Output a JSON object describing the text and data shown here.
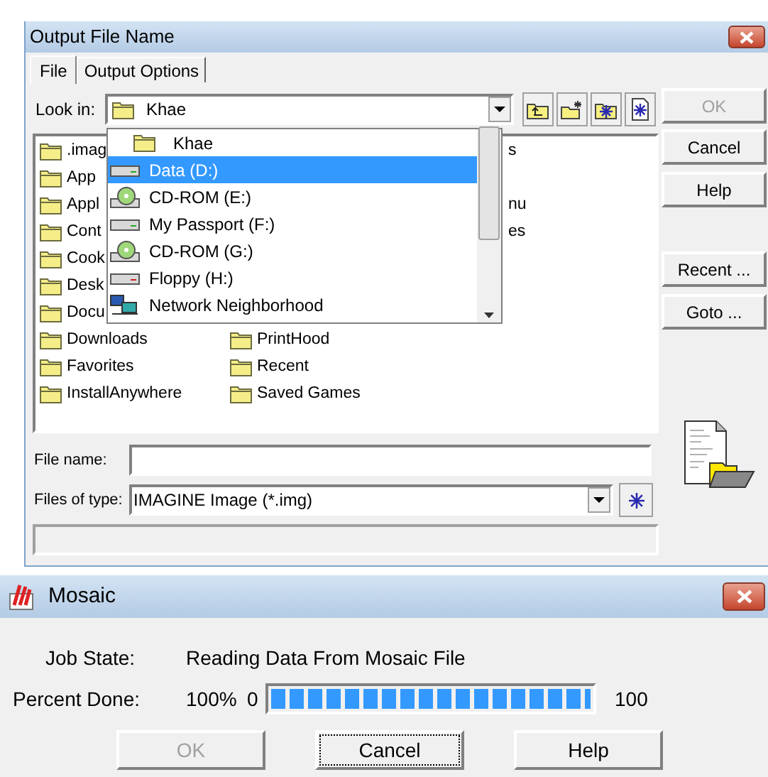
{
  "file_dialog": {
    "title": "Output File Name",
    "tabs": [
      {
        "label": "File",
        "selected": true
      },
      {
        "label": "Output Options",
        "selected": false
      }
    ],
    "look_in": {
      "label": "Look in:",
      "value": "Khae"
    },
    "file_list": {
      "left": [
        {
          "text": ".imag",
          "kind": "folder"
        },
        {
          "text": "App",
          "kind": "folder"
        },
        {
          "text": "Appl",
          "kind": "folder"
        },
        {
          "text": "Cont",
          "kind": "folder"
        },
        {
          "text": "Cook",
          "kind": "folder"
        },
        {
          "text": "Desk",
          "kind": "folder"
        },
        {
          "text": "Docu",
          "kind": "folder"
        },
        {
          "text": "Downloads",
          "kind": "folder"
        },
        {
          "text": "Favorites",
          "kind": "folder"
        },
        {
          "text": "InstallAnywhere",
          "kind": "folder"
        }
      ],
      "right": [
        {
          "text": "s",
          "kind": "partial"
        },
        {
          "kind": "hidden"
        },
        {
          "text": "nu",
          "kind": "partial"
        },
        {
          "text": "es",
          "kind": "partial"
        },
        {
          "kind": "hidden"
        },
        {
          "kind": "hidden"
        },
        {
          "kind": "hidden"
        },
        {
          "text": "PrintHood",
          "kind": "folder"
        },
        {
          "text": "Recent",
          "kind": "folder"
        },
        {
          "text": "Saved Games",
          "kind": "folder"
        }
      ]
    },
    "dropdown": [
      {
        "label": "Khae",
        "kind": "folder",
        "selected": false
      },
      {
        "label": "Data (D:)",
        "kind": "drive",
        "selected": true
      },
      {
        "label": "CD-ROM (E:)",
        "kind": "cdrom",
        "selected": false
      },
      {
        "label": "My Passport (F:)",
        "kind": "drive",
        "selected": false
      },
      {
        "label": "CD-ROM (G:)",
        "kind": "cdrom",
        "selected": false
      },
      {
        "label": "Floppy (H:)",
        "kind": "floppy",
        "selected": false
      },
      {
        "label": "Network Neighborhood",
        "kind": "network",
        "selected": false
      }
    ],
    "buttons": [
      {
        "label": "OK",
        "disabled": true
      },
      {
        "label": "Cancel",
        "disabled": false
      },
      {
        "label": "Help",
        "disabled": false
      },
      {
        "label": "Recent ...",
        "disabled": false
      },
      {
        "label": "Goto ...",
        "disabled": false
      }
    ],
    "file_name": {
      "label": "File name:"
    },
    "files_of_type": {
      "label": "Files of type:",
      "value": "IMAGINE Image (*.img)"
    }
  },
  "mosaic": {
    "title": "Mosaic",
    "job_state": {
      "label": "Job State:",
      "value": "Reading Data From Mosaic File"
    },
    "percent_done": {
      "label": "Percent Done:",
      "value": "100%",
      "min": "0",
      "max": "100",
      "level": 1
    },
    "buttons": [
      {
        "label": "OK",
        "disabled": true,
        "focused": false
      },
      {
        "label": "Cancel",
        "disabled": false,
        "focused": true
      },
      {
        "label": "Help",
        "disabled": false,
        "focused": false
      }
    ]
  }
}
